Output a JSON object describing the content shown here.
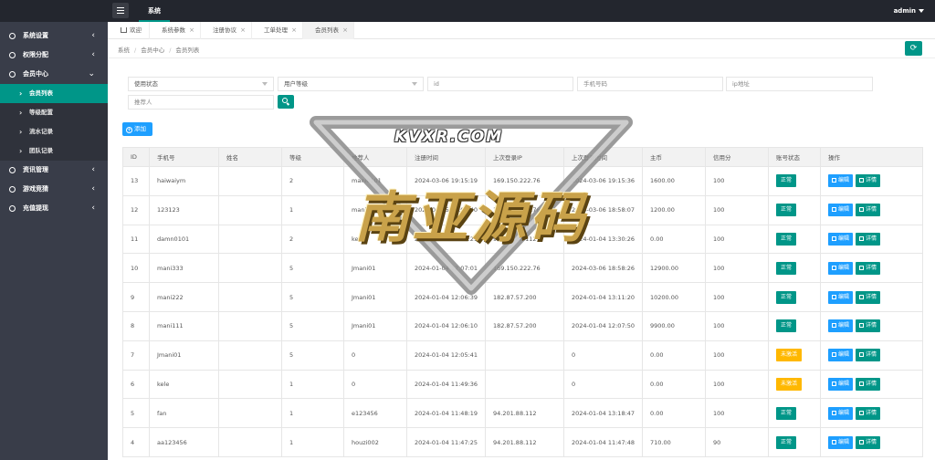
{
  "header": {
    "nav_label": "系统",
    "user": "admin"
  },
  "sidebar": {
    "items": [
      {
        "label": "系统设置",
        "icon": "gear-icon",
        "arrow": "‹"
      },
      {
        "label": "权限分配",
        "icon": "key-icon",
        "arrow": "‹"
      },
      {
        "label": "会员中心",
        "icon": "user-icon",
        "arrow": "⌄"
      },
      {
        "label": "资讯管理",
        "icon": "news-icon",
        "arrow": "‹"
      },
      {
        "label": "游戏竞猜",
        "icon": "game-icon",
        "arrow": "‹"
      },
      {
        "label": "充值提现",
        "icon": "wallet-icon",
        "arrow": "‹"
      }
    ],
    "sub_items": [
      {
        "label": "会员列表",
        "active": true
      },
      {
        "label": "等级配置"
      },
      {
        "label": "流水记录"
      },
      {
        "label": "团队记录"
      }
    ]
  },
  "tabs": [
    {
      "label": "欢迎",
      "closable": false
    },
    {
      "label": "系统参数"
    },
    {
      "label": "注册协议"
    },
    {
      "label": "工单处理"
    },
    {
      "label": "会员列表",
      "active": true
    }
  ],
  "breadcrumb": [
    "系统",
    "会员中心",
    "会员列表"
  ],
  "filters": {
    "status_select": "使用状态",
    "level_select": "用户等级",
    "id_placeholder": "id",
    "phone_placeholder": "手机号码",
    "ip_placeholder": "ip地址",
    "referrer_placeholder": "推荐人"
  },
  "add_label": "添加",
  "table": {
    "headers": [
      "ID",
      "手机号",
      "姓名",
      "等级",
      "推荐人",
      "注册时间",
      "上次登录IP",
      "上次登录时间",
      "主币",
      "信用分",
      "账号状态",
      "操作"
    ],
    "edit_label": "编辑",
    "detail_label": "详情",
    "rows": [
      {
        "id": "13",
        "phone": "haiwaiym",
        "name": "",
        "level": "2",
        "referrer": "mani0101",
        "reg_time": "2024-03-06 19:15:19",
        "ip": "169.150.222.76",
        "login_time": "2024-03-06 19:15:36",
        "coin": "1600.00",
        "credit": "100",
        "status": "正常",
        "status_type": "ok"
      },
      {
        "id": "12",
        "phone": "123123",
        "name": "",
        "level": "1",
        "referrer": "mani333",
        "reg_time": "2024-01-05 11:01:40",
        "ip": "169.150.222.76",
        "login_time": "2024-03-06 18:58:07",
        "coin": "1200.00",
        "credit": "100",
        "status": "正常",
        "status_type": "ok"
      },
      {
        "id": "11",
        "phone": "damn0101",
        "name": "",
        "level": "2",
        "referrer": "kele",
        "reg_time": "2024-01-04 13:11:21",
        "ip": "94.201.88.112",
        "login_time": "2024-01-04 13:30:26",
        "coin": "0.00",
        "credit": "100",
        "status": "正常",
        "status_type": "ok"
      },
      {
        "id": "10",
        "phone": "mani333",
        "name": "",
        "level": "5",
        "referrer": "Jmani01",
        "reg_time": "2024-01-04 12:07:01",
        "ip": "169.150.222.76",
        "login_time": "2024-03-06 18:58:26",
        "coin": "12900.00",
        "credit": "100",
        "status": "正常",
        "status_type": "ok"
      },
      {
        "id": "9",
        "phone": "mani222",
        "name": "",
        "level": "5",
        "referrer": "Jmani01",
        "reg_time": "2024-01-04 12:06:39",
        "ip": "182.87.57.200",
        "login_time": "2024-01-04 13:11:20",
        "coin": "10200.00",
        "credit": "100",
        "status": "正常",
        "status_type": "ok"
      },
      {
        "id": "8",
        "phone": "mani111",
        "name": "",
        "level": "5",
        "referrer": "Jmani01",
        "reg_time": "2024-01-04 12:06:10",
        "ip": "182.87.57.200",
        "login_time": "2024-01-04 12:07:50",
        "coin": "9900.00",
        "credit": "100",
        "status": "正常",
        "status_type": "ok"
      },
      {
        "id": "7",
        "phone": "Jmani01",
        "name": "",
        "level": "5",
        "referrer": "0",
        "reg_time": "2024-01-04 12:05:41",
        "ip": "",
        "login_time": "0",
        "coin": "0.00",
        "credit": "100",
        "status": "未激活",
        "status_type": "warn"
      },
      {
        "id": "6",
        "phone": "kele",
        "name": "",
        "level": "1",
        "referrer": "0",
        "reg_time": "2024-01-04 11:49:36",
        "ip": "",
        "login_time": "0",
        "coin": "0.00",
        "credit": "100",
        "status": "未激活",
        "status_type": "warn"
      },
      {
        "id": "5",
        "phone": "fan",
        "name": "",
        "level": "1",
        "referrer": "e123456",
        "reg_time": "2024-01-04 11:48:19",
        "ip": "94.201.88.112",
        "login_time": "2024-01-04 13:18:47",
        "coin": "0.00",
        "credit": "100",
        "status": "正常",
        "status_type": "ok"
      },
      {
        "id": "4",
        "phone": "aa123456",
        "name": "",
        "level": "1",
        "referrer": "houzi002",
        "reg_time": "2024-01-04 11:47:25",
        "ip": "94.201.88.112",
        "login_time": "2024-01-04 11:47:48",
        "coin": "710.00",
        "credit": "90",
        "status": "正常",
        "status_type": "ok"
      }
    ]
  },
  "watermark": {
    "top": "KVXR.COM",
    "main": "南亚源码"
  },
  "colors": {
    "accent": "#009688",
    "blue": "#1e9fff",
    "warn": "#ffb800",
    "sidebar": "#393d49",
    "header": "#23262e"
  }
}
